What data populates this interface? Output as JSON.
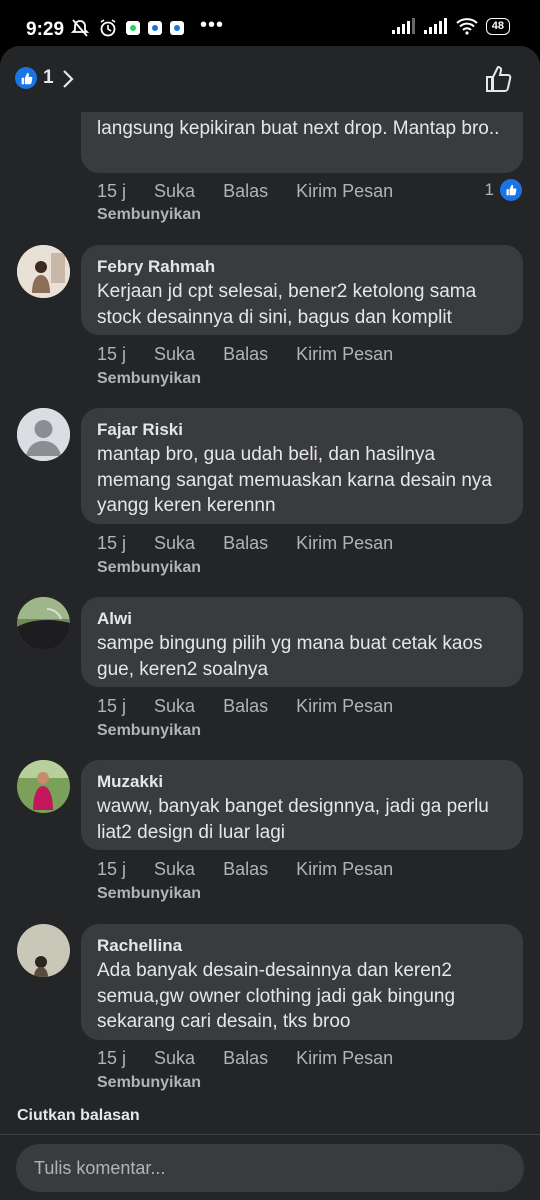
{
  "status": {
    "time": "9:29",
    "battery": "48"
  },
  "header": {
    "reaction_count": "1"
  },
  "top_comment": {
    "text_tail": "langsung kepikiran buat next drop. Mantap bro..",
    "time": "15 j",
    "like": "Suka",
    "reply": "Balas",
    "send": "Kirim Pesan",
    "hide": "Sembunyikan",
    "reactions": "1"
  },
  "comments": [
    {
      "author": "Febry Rahmah",
      "text": "Kerjaan jd cpt selesai, bener2 ketolong sama stock desainnya di sini, bagus dan komplit",
      "time": "15 j",
      "like": "Suka",
      "reply": "Balas",
      "send": "Kirim Pesan",
      "hide": "Sembunyikan"
    },
    {
      "author": "Fajar Riski",
      "text": "mantap bro, gua udah beli, dan hasilnya memang sangat memuaskan karna desain nya yangg keren kerennn",
      "time": "15 j",
      "like": "Suka",
      "reply": "Balas",
      "send": "Kirim Pesan",
      "hide": "Sembunyikan"
    },
    {
      "author": "Alwi",
      "text": "sampe bingung pilih yg mana buat cetak kaos gue, keren2 soalnya",
      "time": "15 j",
      "like": "Suka",
      "reply": "Balas",
      "send": "Kirim Pesan",
      "hide": "Sembunyikan"
    },
    {
      "author": "Muzakki",
      "text": "waww, banyak banget designnya, jadi ga perlu liat2 design di luar lagi",
      "time": "15 j",
      "like": "Suka",
      "reply": "Balas",
      "send": "Kirim Pesan",
      "hide": "Sembunyikan"
    },
    {
      "author": "Rachellina",
      "text": "Ada banyak desain-desainnya dan keren2 semua,gw owner clothing jadi gak bingung sekarang cari desain, tks broo",
      "time": "15 j",
      "like": "Suka",
      "reply": "Balas",
      "send": "Kirim Pesan",
      "hide": "Sembunyikan"
    }
  ],
  "collapse_label": "Ciutkan balasan",
  "composer": {
    "placeholder": "Tulis komentar..."
  },
  "colors": {
    "background": "#242526",
    "bubble": "#3a3b3c",
    "accent": "#1b74e4",
    "muted": "#b0b3b8"
  }
}
